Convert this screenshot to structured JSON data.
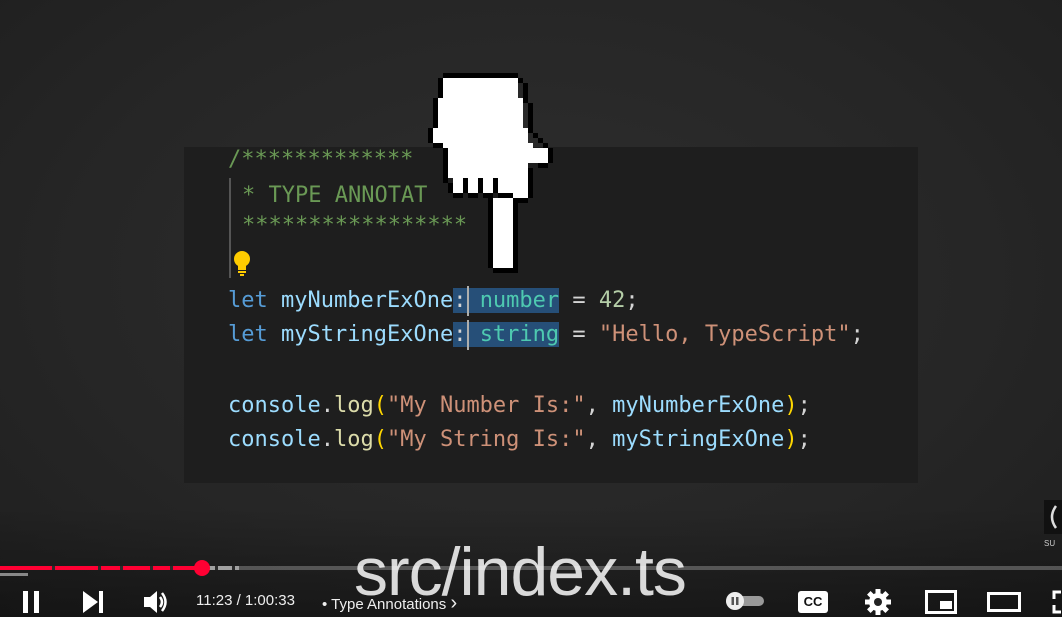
{
  "code": {
    "line1": "/*************",
    "line2_star": "* TYPE ANNOTAT",
    "line3": "*****************",
    "line4_kw": "let",
    "line4_var": "myNumberExOne",
    "line4_colon": ":",
    "line4_type": "number",
    "line4_eq": " = ",
    "line4_num": "42",
    "line4_end": ";",
    "line5_kw": "let",
    "line5_var": "myStringExOne",
    "line5_colon": ":",
    "line5_type": "string",
    "line5_eq": " = ",
    "line5_str": "\"Hello, TypeScript\"",
    "line5_end": ";",
    "line6_obj": "console",
    "line6_dot": ".",
    "line6_fn": "log",
    "line6_open": "(",
    "line6_str": "\"My Number Is:\"",
    "line6_comma": ", ",
    "line6_var": "myNumberExOne",
    "line6_close": ")",
    "line6_end": ";",
    "line7_obj": "console",
    "line7_dot": ".",
    "line7_fn": "log",
    "line7_open": "(",
    "line7_str": "\"My String Is:\"",
    "line7_comma": ", ",
    "line7_var": "myStringExOne",
    "line7_close": ")",
    "line7_end": ";"
  },
  "overlay_title": "src/index.ts",
  "player": {
    "time": "11:23 / 1:00:33",
    "separator": "•",
    "chapter": "Type Annotations",
    "chapter_arrow": "›",
    "cc_label": "CC",
    "side_label": "SU",
    "progress_played": 0.19,
    "progress_loaded": 0.225
  },
  "colors": {
    "accent": "#ff0033",
    "code_bg": "#1e1e1e"
  },
  "icons": [
    "play-pause-icon",
    "next-icon",
    "volume-icon",
    "autoplay-toggle-icon",
    "cc-icon",
    "settings-icon",
    "miniplayer-icon",
    "theater-icon",
    "fullscreen-icon",
    "pointer-hand-icon",
    "lightbulb-icon"
  ]
}
